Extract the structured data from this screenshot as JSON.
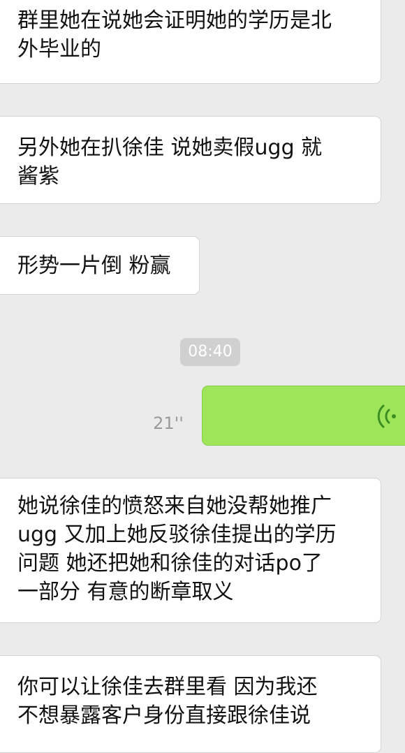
{
  "messages": [
    {
      "text": "群里她在说她会证明她的学历是北\n外毕业的"
    },
    {
      "text": "另外她在扒徐佳 说她卖假ugg 就\n酱紫"
    },
    {
      "text": "形势一片倒 粉赢"
    },
    {
      "text": "她说徐佳的愤怒来自她没帮她推广\nugg 又加上她反驳徐佳提出的学历\n问题 她还把她和徐佳的对话po了\n一部分 有意的断章取义"
    },
    {
      "text": "你可以让徐佳去群里看 因为我还\n不想暴露客户身份直接跟徐佳说"
    }
  ],
  "timestamp": "08:40",
  "voice_message": {
    "duration": "21''",
    "icon": "voice-wave-icon",
    "bubble_color": "#9ee55a"
  },
  "colors": {
    "background": "#ebebeb",
    "incoming_bubble": "#ffffff",
    "outgoing_bubble": "#9ee55a",
    "timestamp_bg": "#d0d0d0"
  }
}
